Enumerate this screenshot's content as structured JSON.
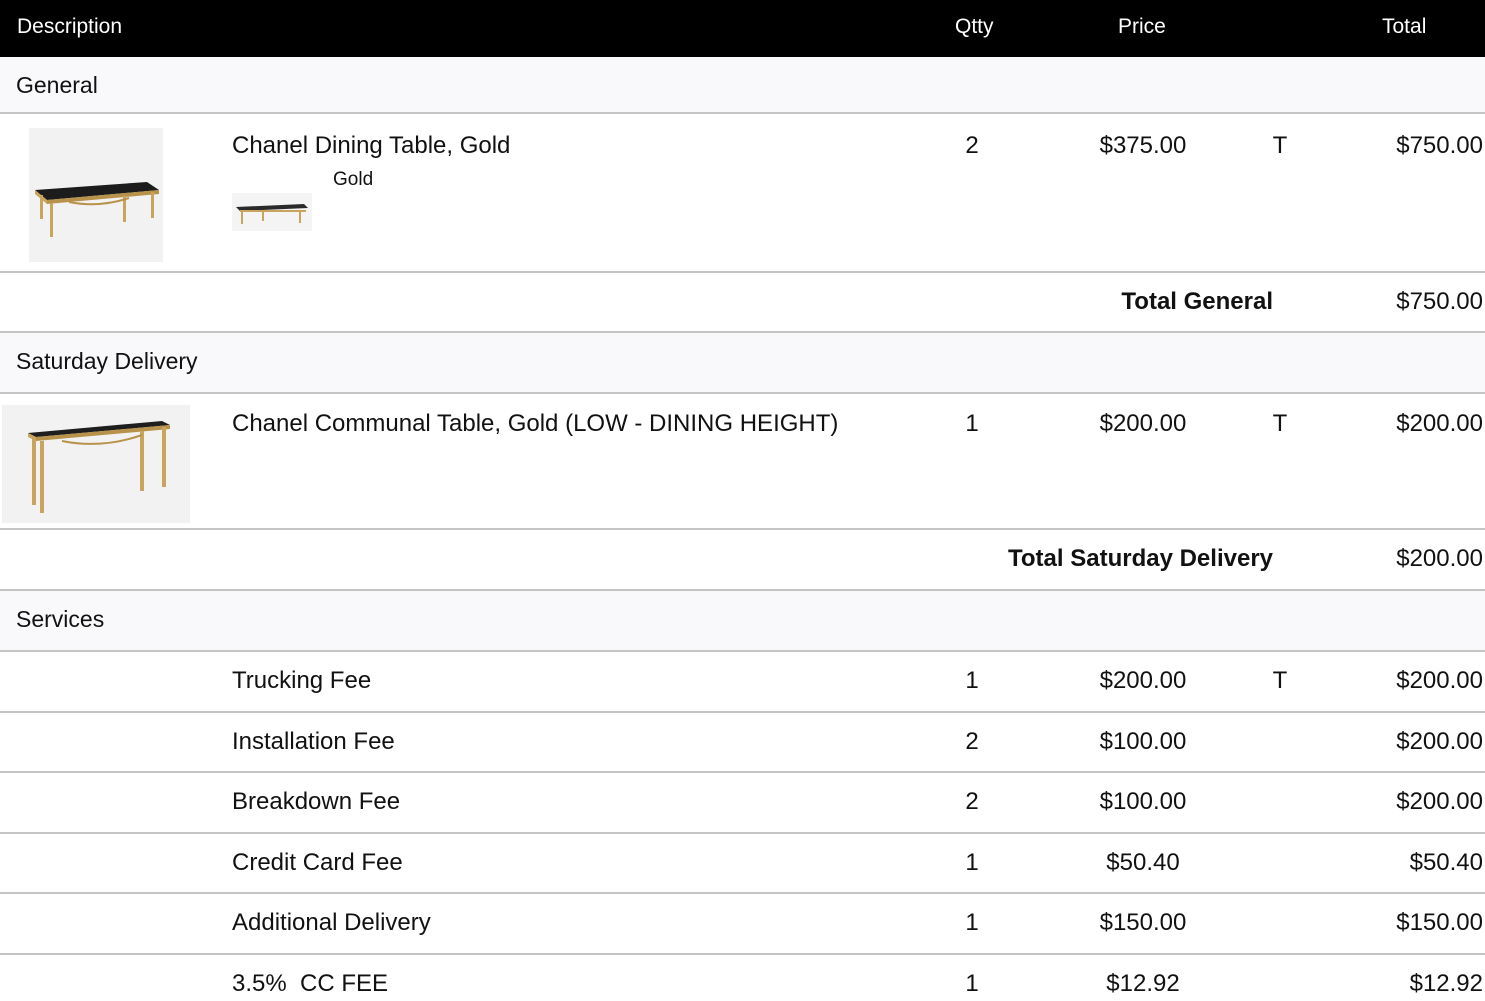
{
  "header": {
    "description": "Description",
    "qty": "Qtty",
    "price": "Price",
    "total": "Total"
  },
  "sections": {
    "general": {
      "title": "General",
      "items": [
        {
          "description": "Chanel Dining Table, Gold",
          "option": "Gold",
          "qty": "2",
          "price": "$375.00",
          "tax": "T",
          "total": "$750.00"
        }
      ],
      "subtotal_label": "Total General",
      "subtotal_amount": "$750.00"
    },
    "saturday": {
      "title": "Saturday Delivery",
      "items": [
        {
          "description": "Chanel Communal Table, Gold (LOW - DINING HEIGHT)",
          "qty": "1",
          "price": "$200.00",
          "tax": "T",
          "total": "$200.00"
        }
      ],
      "subtotal_label": "Total Saturday Delivery",
      "subtotal_amount": "$200.00"
    },
    "services": {
      "title": "Services",
      "items": [
        {
          "description": "Trucking Fee",
          "qty": "1",
          "price": "$200.00",
          "tax": "T",
          "total": "$200.00"
        },
        {
          "description": "Installation Fee",
          "qty": "2",
          "price": "$100.00",
          "tax": "",
          "total": "$200.00"
        },
        {
          "description": "Breakdown Fee",
          "qty": "2",
          "price": "$100.00",
          "tax": "",
          "total": "$200.00"
        },
        {
          "description": "Credit Card Fee",
          "qty": "1",
          "price": "$50.40",
          "tax": "",
          "total": "$50.40"
        },
        {
          "description": "Additional Delivery",
          "qty": "1",
          "price": "$150.00",
          "tax": "",
          "total": "$150.00"
        },
        {
          "description": "3.5%  CC FEE",
          "qty": "1",
          "price": "$12.92",
          "tax": "",
          "total": "$12.92"
        }
      ]
    }
  },
  "colors": {
    "header_bg": "#000000",
    "section_bg": "#f9f9fb",
    "divider": "#c4c4c4",
    "gold": "#c9a45e"
  },
  "icons": {
    "dining_table": "dining-table-image",
    "communal_table": "communal-table-image"
  }
}
